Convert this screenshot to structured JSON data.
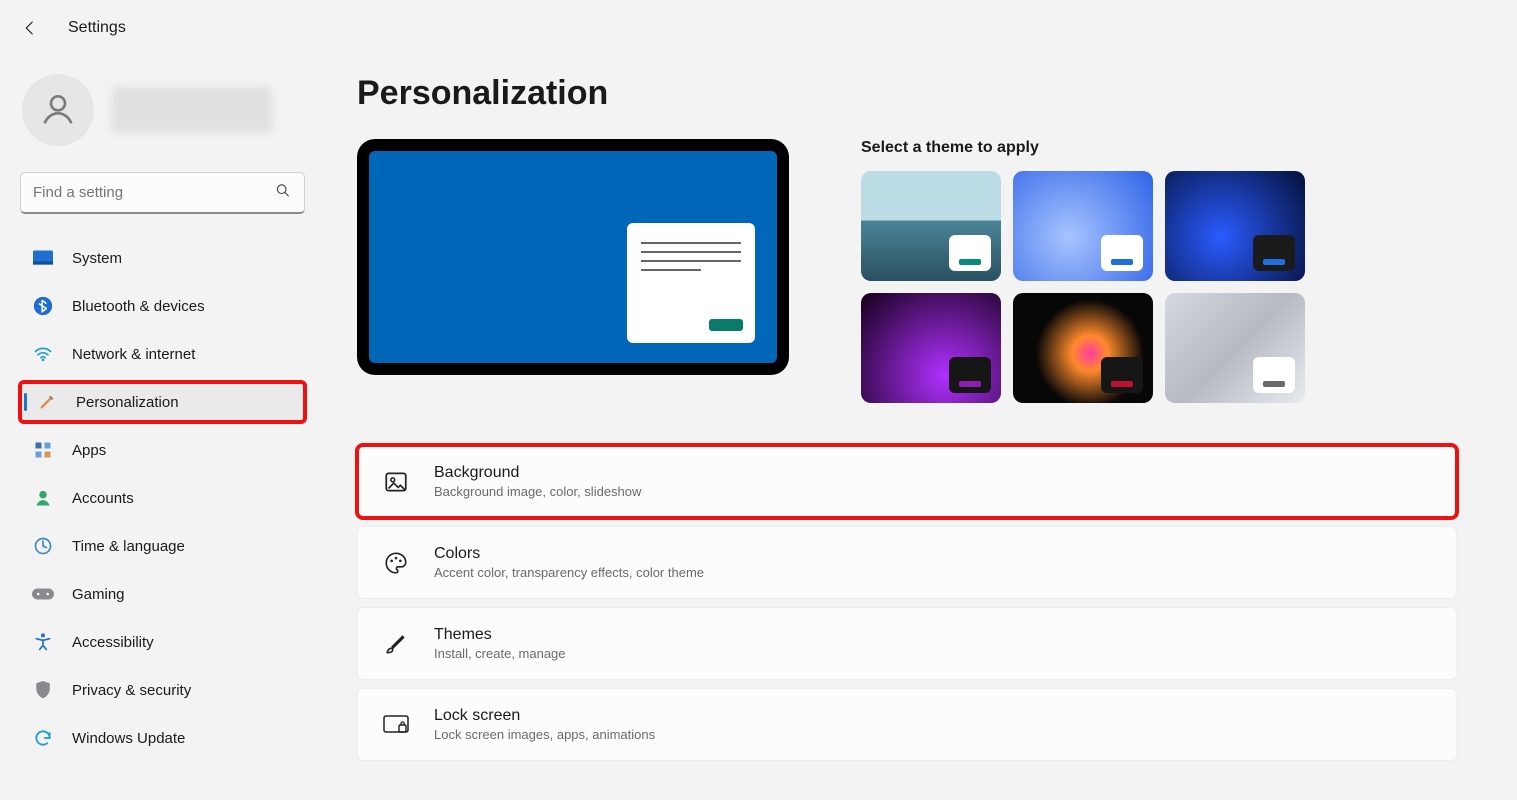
{
  "appTitle": "Settings",
  "search": {
    "placeholder": "Find a setting"
  },
  "nav": {
    "items": [
      {
        "label": "System"
      },
      {
        "label": "Bluetooth & devices"
      },
      {
        "label": "Network & internet"
      },
      {
        "label": "Personalization"
      },
      {
        "label": "Apps"
      },
      {
        "label": "Accounts"
      },
      {
        "label": "Time & language"
      },
      {
        "label": "Gaming"
      },
      {
        "label": "Accessibility"
      },
      {
        "label": "Privacy & security"
      },
      {
        "label": "Windows Update"
      }
    ]
  },
  "page": {
    "title": "Personalization",
    "themesHeading": "Select a theme to apply"
  },
  "options": [
    {
      "title": "Background",
      "desc": "Background image, color, slideshow"
    },
    {
      "title": "Colors",
      "desc": "Accent color, transparency effects, color theme"
    },
    {
      "title": "Themes",
      "desc": "Install, create, manage"
    },
    {
      "title": "Lock screen",
      "desc": "Lock screen images, apps, animations"
    }
  ]
}
